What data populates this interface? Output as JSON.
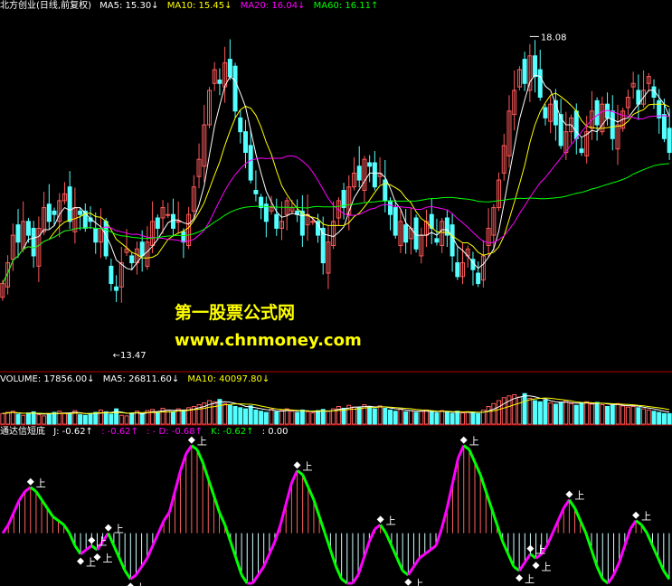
{
  "header": {
    "name": "北方创业(日线,前复权)",
    "ma5": "MA5: 15.30↓",
    "ma10": "MA10: 15.45↓",
    "ma20": "MA20: 16.04↓",
    "ma60": "MA60: 16.11↑"
  },
  "volume_header": {
    "vol": "VOLUME: 17856.00↓",
    "ma5": "MA5: 26811.60↓",
    "ma10": "MA10: 40097.80↓"
  },
  "indicator_header": {
    "name": "通达信短底",
    "j": "J: -0.62↑",
    "v1": ": -0.62↑",
    "v2": ": - D: -0.68↑",
    "k": "K: -0.62↑",
    "v3": ": 0.00"
  },
  "annotations": {
    "high": "18.08",
    "low": "←13.47",
    "signal": "上"
  },
  "watermark": {
    "line1": "第一股票公式网",
    "line2": "www.chnmoney.com"
  },
  "colors": {
    "up": "#ff5a5a",
    "down": "#54ffff",
    "ma5": "#ffffff",
    "ma10": "#ffff00",
    "ma20": "#ff00ff",
    "ma60": "#00ff00",
    "frame": "#b00000"
  },
  "chart_data": [
    {
      "type": "candlestick",
      "title": "北方创业(日线,前复权)",
      "ylim": [
        13.3,
        18.4
      ],
      "annotated_high": 18.08,
      "annotated_low": 13.47,
      "close": [
        14.5,
        14.8,
        15.2,
        15.1,
        15.4,
        15.2,
        14.9,
        15.3,
        15.6,
        15.4,
        15.5,
        15.7,
        15.8,
        15.4,
        15.6,
        15.5,
        15.3,
        15.4,
        15.1,
        15.3,
        14.9,
        14.5,
        14.4,
        14.8,
        15.0,
        14.8,
        15.0,
        14.9,
        15.1,
        15.4,
        15.3,
        15.6,
        15.5,
        15.3,
        15.4,
        15.1,
        15.5,
        15.9,
        16.3,
        16.8,
        17.3,
        17.6,
        17.4,
        17.7,
        17.5,
        17.0,
        16.7,
        16.4,
        16.0,
        15.8,
        15.6,
        15.4,
        15.6,
        15.3,
        15.4,
        15.7,
        15.6,
        15.5,
        15.2,
        15.5,
        15.4,
        15.2,
        14.8,
        15.1,
        15.4,
        15.7,
        15.6,
        15.9,
        16.1,
        16.0,
        16.3,
        16.2,
        15.9,
        16.1,
        15.7,
        15.5,
        15.2,
        15.4,
        15.1,
        15.3,
        15.0,
        15.2,
        15.4,
        15.3,
        15.1,
        15.4,
        15.2,
        14.9,
        14.6,
        14.8,
        15.0,
        14.7,
        14.5,
        14.9,
        15.3,
        15.6,
        16.0,
        16.5,
        17.0,
        17.3,
        17.6,
        17.4,
        17.8,
        17.5,
        17.2,
        16.9,
        17.1,
        16.8,
        16.5,
        16.7,
        16.9,
        16.6,
        16.4,
        16.7,
        17.0,
        16.8,
        17.1,
        16.9,
        16.6,
        16.8,
        17.0,
        17.2,
        17.4,
        17.1,
        17.3,
        17.5,
        17.2,
        16.9,
        16.6,
        16.4
      ]
    },
    {
      "type": "bar",
      "title": "VOLUME",
      "ylim": [
        0,
        60000
      ],
      "values": [
        18000,
        20000,
        22000,
        17000,
        15000,
        19000,
        21000,
        16000,
        14000,
        18000,
        20000,
        22000,
        19000,
        17000,
        23000,
        16000,
        15000,
        18000,
        20000,
        24000,
        21000,
        17000,
        26000,
        15000,
        14000,
        19000,
        22000,
        18000,
        23000,
        25000,
        20000,
        27000,
        24000,
        21000,
        26000,
        22000,
        28000,
        30000,
        33000,
        36000,
        40000,
        38000,
        42000,
        35000,
        32000,
        30000,
        28000,
        26000,
        31000,
        24000,
        22000,
        20000,
        25000,
        21000,
        23000,
        26000,
        22000,
        20000,
        24000,
        21000,
        19000,
        23000,
        25000,
        22000,
        26000,
        30000,
        27000,
        32000,
        29000,
        28000,
        33000,
        30000,
        26000,
        31000,
        27000,
        24000,
        22000,
        25000,
        21000,
        23000,
        20000,
        22000,
        24000,
        21000,
        19000,
        23000,
        20000,
        18000,
        22000,
        19000,
        21000,
        20000,
        18000,
        24000,
        30000,
        35000,
        40000,
        45000,
        48000,
        50000,
        46000,
        52000,
        44000,
        40000,
        38000,
        41000,
        36000,
        34000,
        37000,
        40000,
        35000,
        32000,
        36000,
        38000,
        34000,
        37000,
        33000,
        30000,
        32000,
        35000,
        31000,
        29000,
        30000,
        28000,
        26000,
        24000,
        22000,
        20000,
        18000,
        17856
      ]
    },
    {
      "type": "line",
      "title": "通达信短底",
      "ylim": [
        -12,
        22
      ],
      "signal_label": "上",
      "values": [
        0,
        2,
        5,
        8,
        10,
        11,
        10,
        8,
        6,
        4,
        3,
        2,
        0,
        -3,
        -5,
        -4,
        -3,
        -4,
        -2,
        0,
        -3,
        -6,
        -9,
        -11,
        -10,
        -8,
        -6,
        -3,
        0,
        3,
        5,
        10,
        15,
        19,
        21,
        20,
        17,
        13,
        9,
        5,
        2,
        -2,
        -6,
        -10,
        -12,
        -12,
        -10,
        -8,
        -5,
        -2,
        2,
        7,
        12,
        15,
        14,
        11,
        8,
        4,
        0,
        -4,
        -8,
        -11,
        -12,
        -12,
        -10,
        -6,
        -2,
        1,
        2,
        0,
        -3,
        -6,
        -9,
        -10,
        -8,
        -6,
        -5,
        -4,
        -3,
        1,
        6,
        12,
        18,
        21,
        20,
        17,
        14,
        10,
        6,
        2,
        -2,
        -5,
        -8,
        -9,
        -7,
        -5,
        -6,
        -5,
        -3,
        0,
        3,
        6,
        8,
        6,
        3,
        0,
        -4,
        -8,
        -11,
        -12,
        -10,
        -7,
        -3,
        1,
        3,
        2,
        0,
        -3,
        -6,
        -9,
        -11
      ]
    }
  ]
}
